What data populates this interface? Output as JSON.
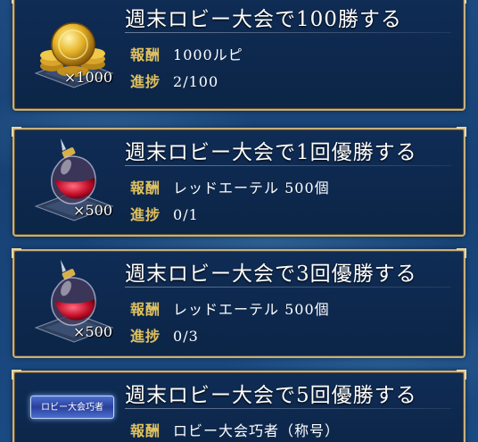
{
  "missions": [
    {
      "title": "週末ロビー大会で100勝する",
      "reward_label": "報酬",
      "reward_value": "1000ルピ",
      "progress_label": "進捗",
      "progress_value": "2/100",
      "icon": "gold-coins-icon",
      "quantity": "×1000"
    },
    {
      "title": "週末ロビー大会で1回優勝する",
      "reward_label": "報酬",
      "reward_value": "レッドエーテル 500個",
      "progress_label": "進捗",
      "progress_value": "0/1",
      "icon": "red-ether-icon",
      "quantity": "×500"
    },
    {
      "title": "週末ロビー大会で3回優勝する",
      "reward_label": "報酬",
      "reward_value": "レッドエーテル 500個",
      "progress_label": "進捗",
      "progress_value": "0/3",
      "icon": "red-ether-icon",
      "quantity": "×500"
    },
    {
      "title": "週末ロビー大会で5回優勝する",
      "reward_label": "報酬",
      "reward_value": "ロビー大会巧者（称号）",
      "icon": "title-badge-icon",
      "badge_text": "ロビー大会巧者"
    }
  ],
  "colors": {
    "card_border": "#c8b07a",
    "label_gold": "#e0c15e",
    "card_bg": "#0f2c55"
  }
}
